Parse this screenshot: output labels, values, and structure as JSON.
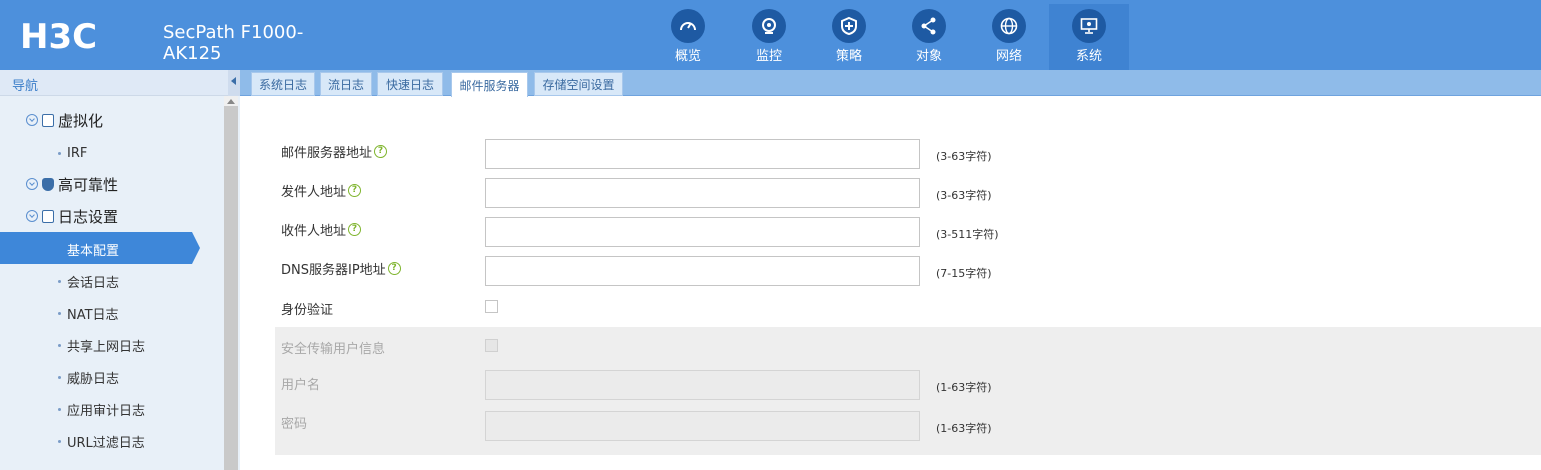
{
  "header": {
    "brand": "H3C",
    "product_line1": "SecPath F1000-",
    "product_line2": "AK125",
    "nav": [
      {
        "label": "概览",
        "icon": "dashboard-icon"
      },
      {
        "label": "监控",
        "icon": "monitor-icon"
      },
      {
        "label": "策略",
        "icon": "shield-plus-icon"
      },
      {
        "label": "对象",
        "icon": "share-icon"
      },
      {
        "label": "网络",
        "icon": "globe-icon"
      },
      {
        "label": "系统",
        "icon": "display-gear-icon",
        "active": true
      }
    ]
  },
  "sidebar": {
    "title": "导航",
    "groups": [
      {
        "label": "虚拟化",
        "children": [
          "IRF"
        ]
      },
      {
        "label": "高可靠性",
        "children": []
      },
      {
        "label": "日志设置",
        "children": [
          "基本配置",
          "会话日志",
          "NAT日志",
          "共享上网日志",
          "威胁日志",
          "应用审计日志",
          "URL过滤日志"
        ]
      }
    ],
    "active_item": "基本配置"
  },
  "tabs": [
    "系统日志",
    "流日志",
    "快速日志",
    "邮件服务器",
    "存储空间设置"
  ],
  "active_tab": "邮件服务器",
  "form": {
    "mail_server": {
      "label": "邮件服务器地址",
      "value": "",
      "hint": "(3-63字符)"
    },
    "sender": {
      "label": "发件人地址",
      "value": "",
      "hint": "(3-63字符)"
    },
    "recipient": {
      "label": "收件人地址",
      "value": "",
      "hint": "(3-511字符)"
    },
    "dns": {
      "label": "DNS服务器IP地址",
      "value": "",
      "hint": "(7-15字符)"
    },
    "auth": {
      "label": "身份验证",
      "checked": false
    },
    "secure": {
      "label": "安全传输用户信息",
      "checked": false
    },
    "username": {
      "label": "用户名",
      "value": "",
      "hint": "(1-63字符)"
    },
    "password": {
      "label": "密码",
      "value": "",
      "hint": "(1-63字符)"
    }
  },
  "colors": {
    "header_bg": "#4d90dc",
    "nav_active_bg": "#3f83d2",
    "nav_icon_bg": "#1e5aa3",
    "sidebar_active": "#3e87d9",
    "help_icon": "#7fb52e"
  }
}
